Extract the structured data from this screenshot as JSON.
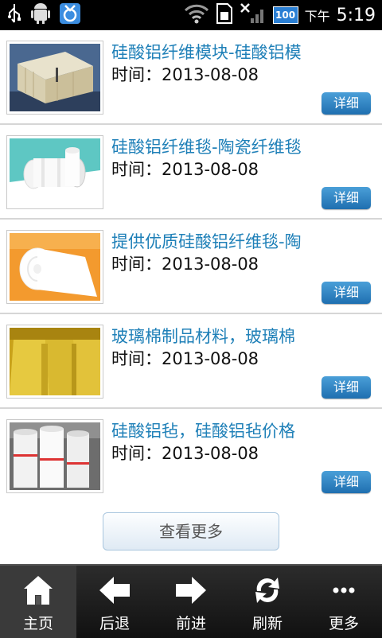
{
  "status_bar": {
    "ampm": "下午",
    "time": "5:19",
    "battery": "100",
    "icons": [
      "usb-icon",
      "android-debug-icon",
      "app-notification-icon",
      "wifi-icon",
      "sd-card-icon",
      "no-signal-icon",
      "battery-icon"
    ]
  },
  "list": {
    "items": [
      {
        "title": "硅酸铝纤维模块-硅酸铝模",
        "time": "时间：2013-08-08",
        "button": "详细"
      },
      {
        "title": "硅酸铝纤维毯-陶瓷纤维毯",
        "time": "时间：2013-08-08",
        "button": "详细"
      },
      {
        "title": "提供优质硅酸铝纤维毯-陶",
        "time": "时间：2013-08-08",
        "button": "详细"
      },
      {
        "title": "玻璃棉制品材料，玻璃棉",
        "time": "时间：2013-08-08",
        "button": "详细"
      },
      {
        "title": "硅酸铝毡，硅酸铝毡价格",
        "time": "时间：2013-08-08",
        "button": "详细"
      }
    ]
  },
  "more_button": "查看更多",
  "nav": {
    "items": [
      {
        "label": "主页",
        "icon": "home-icon"
      },
      {
        "label": "后退",
        "icon": "arrow-left-icon"
      },
      {
        "label": "前进",
        "icon": "arrow-right-icon"
      },
      {
        "label": "刷新",
        "icon": "refresh-icon"
      },
      {
        "label": "更多",
        "icon": "more-dots-icon"
      }
    ]
  },
  "colors": {
    "title": "#1f80b8",
    "button": "#2a7fc0",
    "nav_bg": "#1b1b1b",
    "status_bg": "#000000"
  }
}
